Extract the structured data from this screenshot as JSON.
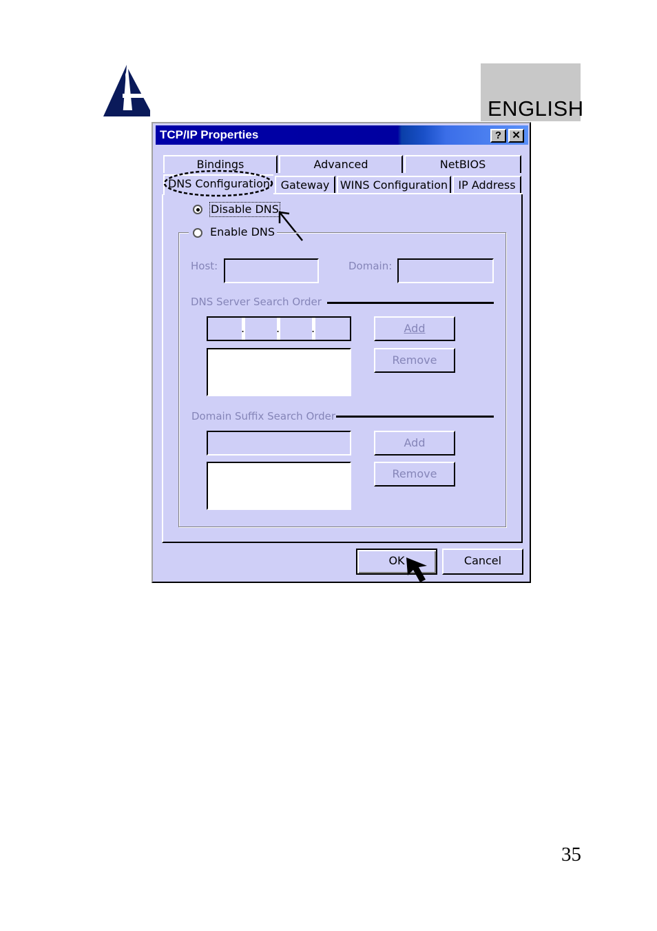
{
  "header": {
    "language_label": "ENGLISH",
    "logo": "atlantis-sail-logo"
  },
  "footer": {
    "page_number": "35"
  },
  "dialog": {
    "title": "TCP/IP Properties",
    "title_buttons": [
      "?",
      "✕"
    ],
    "tabs_row1": [
      "Bindings",
      "Advanced",
      "NetBIOS"
    ],
    "tabs_row2": [
      "DNS Configuration",
      "Gateway",
      "WINS Configuration",
      "IP Address"
    ],
    "active_tab": "DNS Configuration",
    "radio_disable": {
      "label": "Disable DNS",
      "selected": true
    },
    "radio_enable": {
      "label": "Enable DNS",
      "selected": false
    },
    "host_label": "Host:",
    "host_value": "",
    "domain_label": "Domain:",
    "domain_value": "",
    "dns_server_group": "DNS Server Search Order",
    "ip_field_separators": [
      ".",
      ".",
      "."
    ],
    "add_label": "Add",
    "remove_label": "Remove",
    "domain_suffix_group": "Domain Suffix Search Order",
    "add_label_2": "Add",
    "remove_label_2": "Remove",
    "ok_label": "OK",
    "cancel_label": "Cancel"
  },
  "annotations": [
    "ellipse-highlight-dns-configuration-tab",
    "arrow-pointing-to-disable-dns",
    "cursor-arrow-on-ok-button"
  ]
}
